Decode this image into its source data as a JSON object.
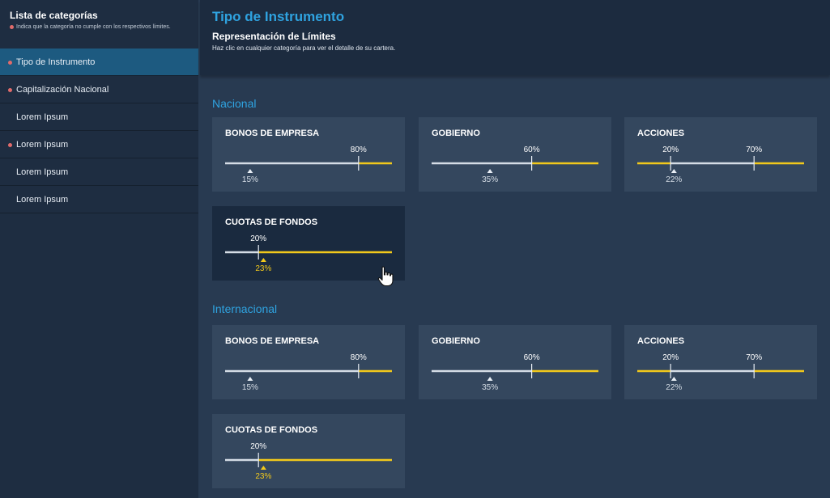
{
  "sidebar": {
    "title": "Lista de categorías",
    "note": "Indica que la categoría no cumple con los respectivos límites.",
    "items": [
      {
        "label": "Tipo de Instrumento",
        "flag": true,
        "active": true
      },
      {
        "label": "Capitalización Nacional",
        "flag": true,
        "active": false
      },
      {
        "label": "Lorem Ipsum",
        "flag": false,
        "active": false
      },
      {
        "label": "Lorem Ipsum",
        "flag": true,
        "active": false
      },
      {
        "label": "Lorem Ipsum",
        "flag": false,
        "active": false
      },
      {
        "label": "Lorem Ipsum",
        "flag": false,
        "active": false
      }
    ]
  },
  "header": {
    "title": "Tipo de Instrumento",
    "subtitle": "Representación de Límites",
    "description": "Haz clic en cualquier categoría para ver el detalle de su cartera."
  },
  "colors": {
    "accent": "#2fa3e0",
    "limit_bar": "#f2c91b",
    "range_bar": "#d5dde6",
    "flag_dot": "#e06b6b"
  },
  "sections": [
    {
      "title": "Nacional",
      "cards": [
        {
          "name": "BONOS DE EMPRESA",
          "kind": "max",
          "limits": [
            80
          ],
          "limit_labels": [
            "80%"
          ],
          "value": 15,
          "value_label": "15%",
          "breach": false
        },
        {
          "name": "GOBIERNO",
          "kind": "max",
          "limits": [
            60
          ],
          "limit_labels": [
            "60%"
          ],
          "value": 35,
          "value_label": "35%",
          "breach": false
        },
        {
          "name": "ACCIONES",
          "kind": "range",
          "limits": [
            20,
            70
          ],
          "limit_labels": [
            "20%",
            "70%"
          ],
          "value": 22,
          "value_label": "22%",
          "breach": false
        },
        {
          "name": "CUOTAS DE FONDOS",
          "kind": "min",
          "limits": [
            20
          ],
          "limit_labels": [
            "20%"
          ],
          "value": 23,
          "value_label": "23%",
          "breach": true,
          "selected": true
        }
      ]
    },
    {
      "title": "Internacional",
      "cards": [
        {
          "name": "BONOS DE EMPRESA",
          "kind": "max",
          "limits": [
            80
          ],
          "limit_labels": [
            "80%"
          ],
          "value": 15,
          "value_label": "15%",
          "breach": false
        },
        {
          "name": "GOBIERNO",
          "kind": "max",
          "limits": [
            60
          ],
          "limit_labels": [
            "60%"
          ],
          "value": 35,
          "value_label": "35%",
          "breach": false
        },
        {
          "name": "ACCIONES",
          "kind": "range",
          "limits": [
            20,
            70
          ],
          "limit_labels": [
            "20%",
            "70%"
          ],
          "value": 22,
          "value_label": "22%",
          "breach": false
        },
        {
          "name": "CUOTAS DE FONDOS",
          "kind": "min",
          "limits": [
            20
          ],
          "limit_labels": [
            "20%"
          ],
          "value": 23,
          "value_label": "23%",
          "breach": true,
          "selected": false
        }
      ]
    }
  ]
}
